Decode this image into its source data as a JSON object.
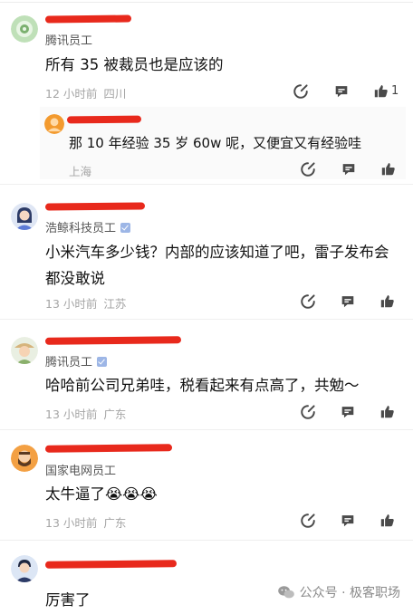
{
  "comments": [
    {
      "company": "腾讯员工",
      "text": "所有 35 被裁员也是应该的",
      "time": "12 小时前",
      "location": "四川",
      "likes": "1"
    },
    {
      "text": "那 10 年经验 35 岁 60w 呢，又便宜又有经验哇",
      "location": "上海"
    },
    {
      "company": "浩鲸科技员工",
      "text": "小米汽车多少钱？内部的应该知道了吧，雷子发布会都没敢说",
      "time": "13 小时前",
      "location": "江苏"
    },
    {
      "company": "腾讯员工",
      "text": "哈哈前公司兄弟哇，税看起来有点高了，共勉～",
      "time": "13 小时前",
      "location": "广东"
    },
    {
      "company": "国家电网员工",
      "text": "太牛逼了😭😭😭",
      "time": "13 小时前",
      "location": "广东"
    },
    {
      "text": "厉害了"
    }
  ],
  "watermark": "公众号 · 极客职场",
  "icons": [
    "avatar-robot",
    "avatar-orange",
    "avatar-woman",
    "avatar-farmer",
    "avatar-beard",
    "avatar-man",
    "reply-icon",
    "comment-icon",
    "like-icon",
    "verified-badge-icon",
    "wechat-icon"
  ],
  "colors": {
    "redaction": "#e8291c",
    "meta": "#a5a5a5",
    "icon": "#4a4a4a"
  }
}
